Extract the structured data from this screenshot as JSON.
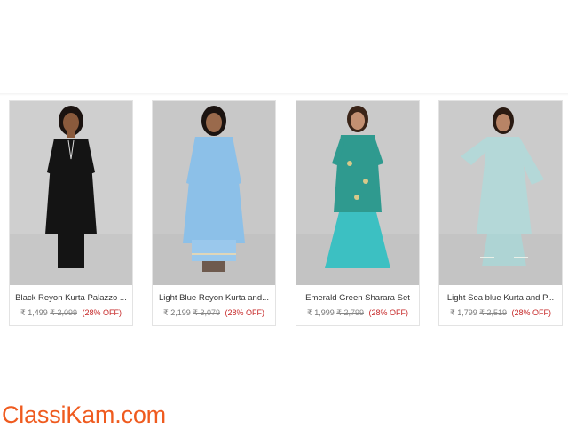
{
  "products": [
    {
      "name": "Black Reyon Kurta Palazzo ...",
      "price": "₹ 1,499",
      "mrp": "₹ 2,099",
      "discount": "(28% OFF)",
      "colors": {
        "bg": "#cfcfcf",
        "dress": "#141414",
        "bottom": "#141414",
        "skin": "#8a5a3c",
        "hair": "#1b1310"
      }
    },
    {
      "name": "Light Blue Reyon Kurta and...",
      "price": "₹ 2,199",
      "mrp": "₹ 3,079",
      "discount": "(28% OFF)",
      "colors": {
        "bg": "#c8c8c8",
        "dress": "#8cc0e8",
        "bottom": "#9ac8ec",
        "skin": "#9a6a4c",
        "hair": "#1b1310"
      }
    },
    {
      "name": "Emerald Green Sharara Set",
      "price": "₹ 1,999",
      "mrp": "₹ 2,799",
      "discount": "(28% OFF)",
      "colors": {
        "bg": "#cacaca",
        "dress": "#2f9a8f",
        "bottom": "#3cc0c2",
        "skin": "#c39072",
        "hair": "#3a2418"
      }
    },
    {
      "name": "Light Sea blue Kurta and P...",
      "price": "₹ 1,799",
      "mrp": "₹ 2,519",
      "discount": "(28% OFF)",
      "colors": {
        "bg": "#cbcbcb",
        "dress": "#b4d8d8",
        "bottom": "#aed4d4",
        "skin": "#b88466",
        "hair": "#2a1a12"
      }
    }
  ],
  "logo": {
    "text": "ClassiKam.com",
    "color": "#ef5b1f"
  }
}
